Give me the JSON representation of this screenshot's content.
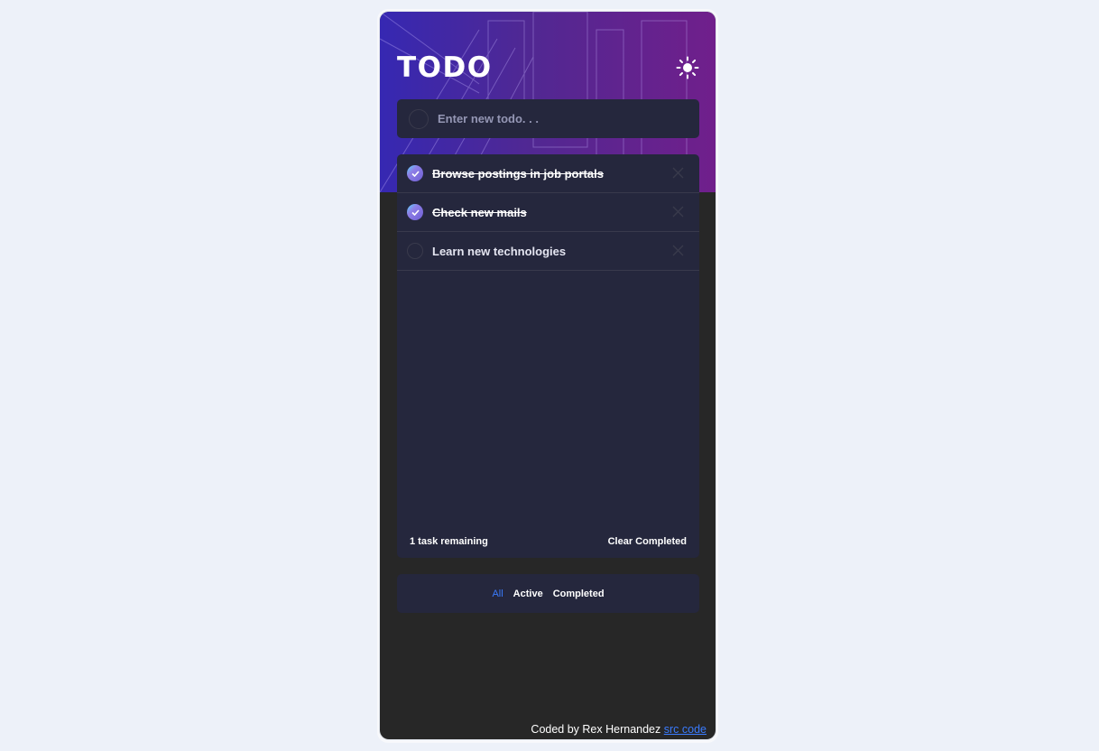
{
  "app": {
    "title": "TODO",
    "theme_icon": "sun-icon"
  },
  "new_todo": {
    "placeholder": "Enter new todo. . ."
  },
  "todos": [
    {
      "text": "Browse postings in job portals",
      "completed": true
    },
    {
      "text": "Check new mails",
      "completed": true
    },
    {
      "text": "Learn new technologies",
      "completed": false
    }
  ],
  "footer": {
    "remaining": "1 task remaining",
    "clear_label": "Clear Completed"
  },
  "filters": {
    "all": "All",
    "active": "Active",
    "completed": "Completed",
    "selected": "All"
  },
  "credit": {
    "text": "Coded by Rex Hernandez",
    "link_label": "src code"
  },
  "colors": {
    "background": "#272727",
    "card": "#25273d",
    "accent": "#3a7bfd",
    "check_gradient_start": "#57ddff",
    "check_gradient_end": "#6e5ed4"
  }
}
